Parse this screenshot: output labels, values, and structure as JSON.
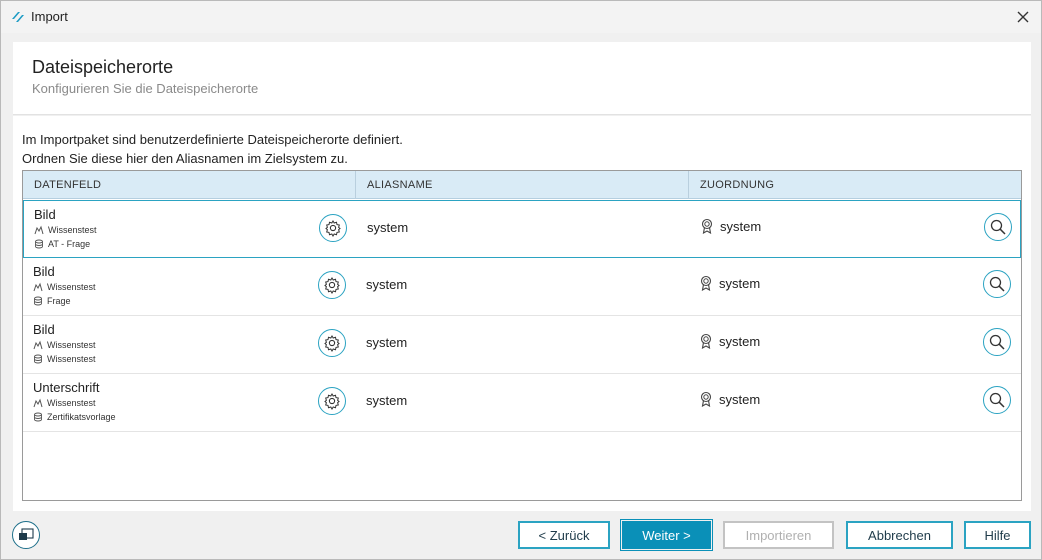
{
  "window": {
    "title": "Import"
  },
  "header": {
    "title": "Dateispeicherorte",
    "subtitle": "Konfigurieren Sie die Dateispeicherorte"
  },
  "intro": {
    "line1": "Im Importpaket sind benutzerdefinierte Dateispeicherorte definiert.",
    "line2": "Ordnen Sie diese hier den Aliasnamen im Zielsystem zu."
  },
  "table": {
    "columns": [
      "DATENFELD",
      "ALIASNAME",
      "ZUORDNUNG"
    ],
    "rows": [
      {
        "name": "Bild",
        "sub1": "Wissenstest",
        "sub2": "AT - Frage",
        "alias": "system",
        "assignment": "system"
      },
      {
        "name": "Bild",
        "sub1": "Wissenstest",
        "sub2": "Frage",
        "alias": "system",
        "assignment": "system"
      },
      {
        "name": "Bild",
        "sub1": "Wissenstest",
        "sub2": "Wissenstest",
        "alias": "system",
        "assignment": "system"
      },
      {
        "name": "Unterschrift",
        "sub1": "Wissenstest",
        "sub2": "Zertifikatsvorlage",
        "alias": "system",
        "assignment": "system"
      }
    ]
  },
  "footer": {
    "back_label": "< Zurück",
    "next_label": "Weiter >",
    "import_label": "Importieren",
    "cancel_label": "Abbrechen",
    "help_label": "Hilfe"
  },
  "colors": {
    "accent": "#2ba3c2",
    "primary": "#0a90b8",
    "header_bg": "#d9ebf6"
  },
  "icons": [
    "app-icon",
    "close-icon",
    "gear-icon",
    "search-icon",
    "award-icon",
    "module-icon",
    "database-icon",
    "window-toggle-icon"
  ]
}
